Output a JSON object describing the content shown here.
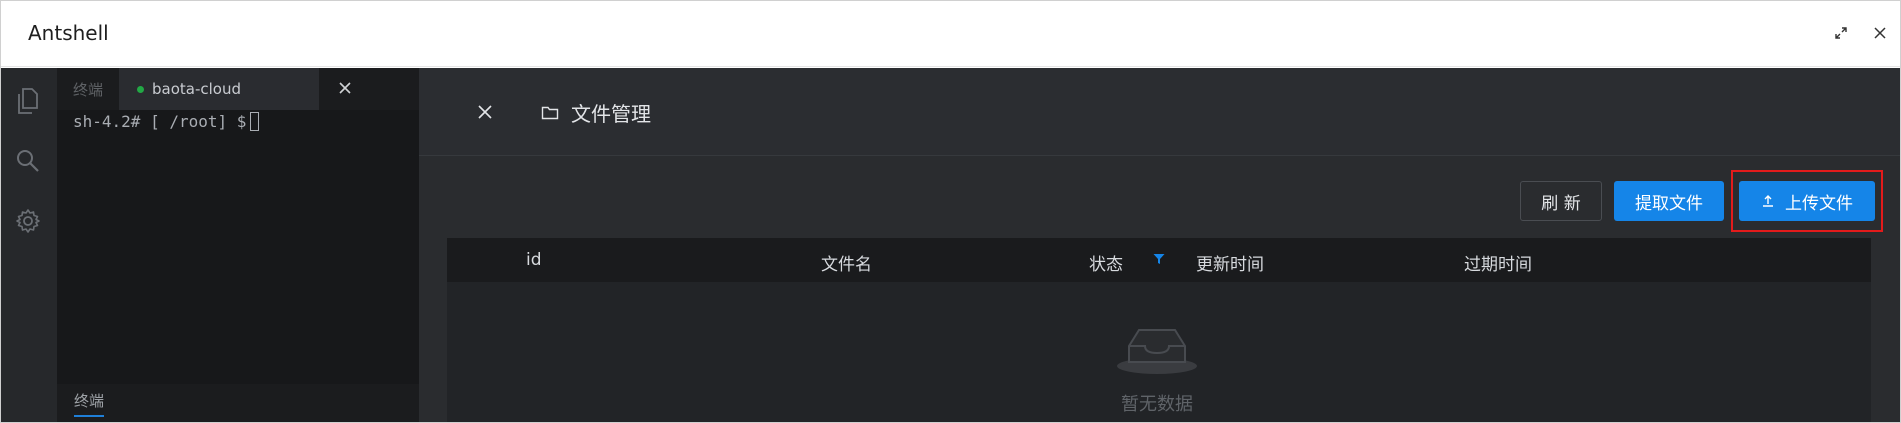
{
  "app": {
    "title": "Antshell"
  },
  "terminal": {
    "tabs": [
      {
        "label": "终端"
      },
      {
        "label": "baota-cloud",
        "status_color": "#22a845"
      }
    ],
    "tab_close_label": "X",
    "prompt": "sh-4.2# [ /root] $",
    "bottom_tab": "终端"
  },
  "file_manager": {
    "title": "文件管理",
    "buttons": {
      "refresh": "刷 新",
      "fetch": "提取文件",
      "upload": "上传文件"
    },
    "table": {
      "columns": {
        "id": "id",
        "filename": "文件名",
        "status": "状态",
        "updated": "更新时间",
        "expire": "过期时间"
      },
      "empty_text": "暂无数据"
    }
  },
  "colors": {
    "accent": "#1585e8",
    "highlight": "#e31b1b"
  }
}
